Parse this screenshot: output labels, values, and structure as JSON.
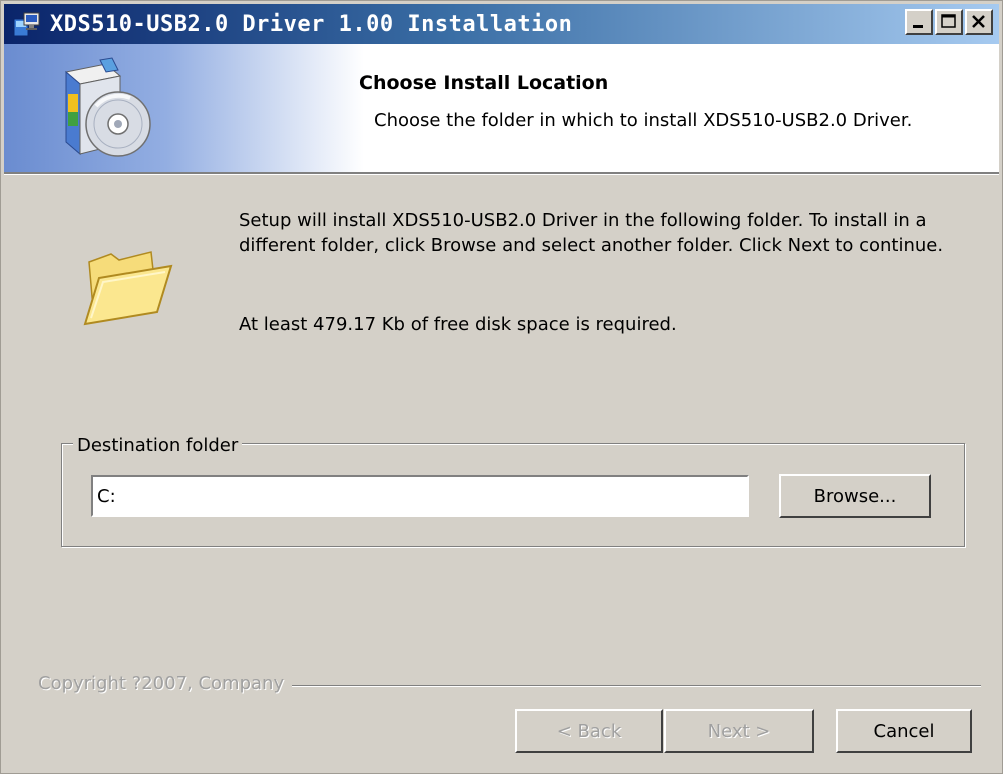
{
  "window": {
    "title": "XDS510-USB2.0 Driver 1.00 Installation"
  },
  "header": {
    "title": "Choose Install Location",
    "subtitle": "Choose the folder in which to install XDS510-USB2.0 Driver."
  },
  "body": {
    "intro": "Setup will install XDS510-USB2.0 Driver in the following folder. To install in a different folder, click Browse and select another folder. Click Next to continue.",
    "space_required": "At least 479.17 Kb of free disk space is required."
  },
  "destination": {
    "legend": "Destination folder",
    "value": "C:",
    "browse_label": "Browse..."
  },
  "footer": {
    "copyright": "Copyright ?2007, Company",
    "back_label": "< Back",
    "next_label": "Next >",
    "cancel_label": "Cancel"
  },
  "icons": {
    "app": "installer-app-icon",
    "header": "software-box-cd-icon",
    "folder": "folder-icon",
    "minimize": "minimize-icon",
    "maximize": "maximize-icon",
    "close": "close-icon"
  },
  "colors": {
    "titlebar_start": "#0a246a",
    "titlebar_end": "#a6caf0",
    "face": "#d4d0c8",
    "disabled_text": "#a0a0a0"
  }
}
